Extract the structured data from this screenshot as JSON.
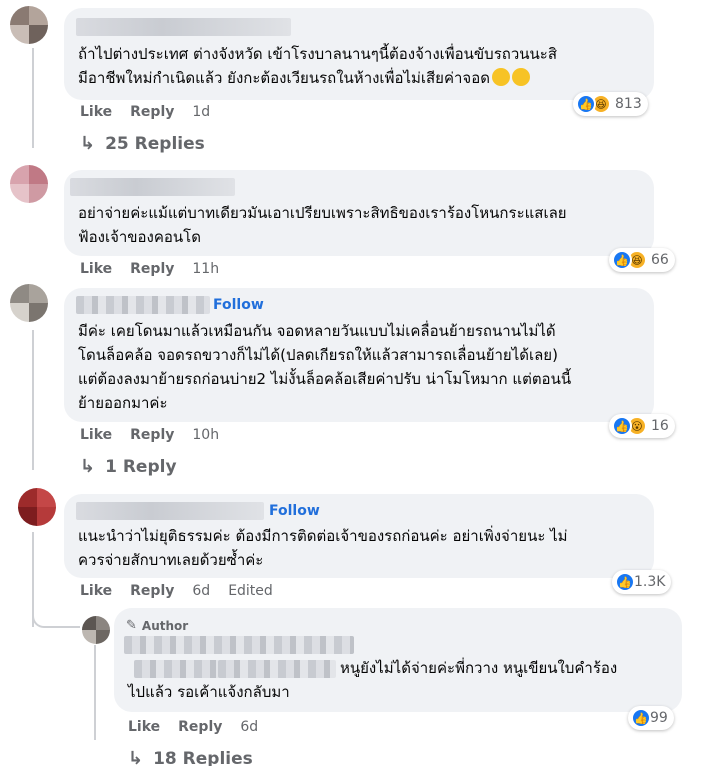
{
  "comments": [
    {
      "lines": [
        "ถ้าไปต่างประเทศ ต่างจังหวัด เข้าโรงบาลนานๆนี้ต้องจ้างเพื่อนขับรถวนนะสิ",
        "มีอาชีพใหม่กำเนิดแล้ว ยังกะต้องเวียนรถในห้างเพื่อไม่เสียค่าจอด"
      ],
      "like": "Like",
      "reply": "Reply",
      "time": "1d",
      "reaction_count": "813",
      "replies_label": "25 Replies"
    },
    {
      "lines": [
        "อย่าจ่ายค่ะแม้แต่บาทเดียวมันเอาเปรียบเพราะสิทธิของเราร้องโหนกระแสเลย",
        "ฟ้องเจ้าของคอนโด"
      ],
      "like": "Like",
      "reply": "Reply",
      "time": "11h",
      "reaction_count": "66"
    },
    {
      "follow": "Follow",
      "lines": [
        "มีค่ะ เคยโดนมาแล้วเหมือนกัน จอดหลายวันแบบไม่เคลื่อนย้ายรถนานไม่ได้",
        "โดนล็อคล้อ จอดรถขวางก็ไม่ได้(ปลดเกียรถให้แล้วสามารถเลื่อนย้ายได้เลย)",
        "แต่ต้องลงมาย้ายรถก่อนบ่าย2 ไม่งั้นล็อคล้อเสียค่าปรับ น่าโมโหมาก แต่ตอนนี้",
        "ย้ายออกมาค่ะ"
      ],
      "like": "Like",
      "reply": "Reply",
      "time": "10h",
      "reaction_count": "16",
      "replies_label": "1 Reply"
    },
    {
      "follow": "Follow",
      "lines": [
        "แนะนำว่าไม่ยุติธรรมค่ะ ต้องมีการติดต่อเจ้าของรถก่อนค่ะ อย่าเพิ่งจ่ายนะ ไม่",
        "ควรจ่ายสักบาทเลยด้วยซ้ำค่ะ"
      ],
      "like": "Like",
      "reply": "Reply",
      "time": "6d",
      "edited": "Edited",
      "reaction_count": "1.3K"
    }
  ],
  "reply": {
    "author_badge": "Author",
    "lines": [
      "หนูยังไม่ได้จ่ายค่ะพี่กวาง หนูเขียนใบคำร้อง",
      "ไปแล้ว รอเค้าแจ้งกลับมา"
    ],
    "like": "Like",
    "reply": "Reply",
    "time": "6d",
    "reaction_count": "99",
    "replies_label": "18 Replies"
  },
  "icons": {
    "like": "👍",
    "haha": "😆",
    "wow": "😮",
    "thinking": "🤔",
    "reply_arrow": "↳",
    "pencil": "✎"
  },
  "colors": {
    "bubble": "#f0f2f5",
    "link": "#216fdb",
    "secondary_text": "#65676b",
    "like_blue": "#1877f2",
    "emoji_yellow": "#f7b125"
  }
}
